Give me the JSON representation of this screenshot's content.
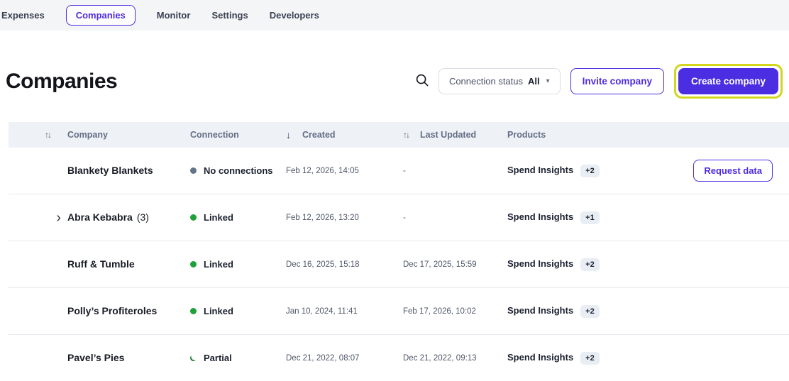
{
  "nav": {
    "items": [
      {
        "label": "Expenses",
        "active": false
      },
      {
        "label": "Companies",
        "active": true
      },
      {
        "label": "Monitor",
        "active": false
      },
      {
        "label": "Settings",
        "active": false
      },
      {
        "label": "Developers",
        "active": false
      }
    ]
  },
  "header": {
    "title": "Companies",
    "filter_label": "Connection status",
    "filter_value": "All",
    "invite_label": "Invite company",
    "create_label": "Create company"
  },
  "icons": {
    "search": "magnifier",
    "filter_caret": "▾",
    "sort_both": "↑↓",
    "sort_desc": "↓",
    "expand": "›"
  },
  "colors": {
    "accent_purple": "#4f2be0",
    "primary_button": "#4b2ee2",
    "highlight_yellow": "#d3d61d",
    "linked_green": "#1ea03a",
    "partial_green": "#1d7c2f",
    "no_connection_gray": "#64748b",
    "header_bg": "#eef1f6",
    "nav_bg": "#f4f5f7"
  },
  "table": {
    "columns": [
      {
        "label": "Company",
        "sort": "both"
      },
      {
        "label": "Connection",
        "sort": "none"
      },
      {
        "label": "Created",
        "sort": "desc"
      },
      {
        "label": "Last Updated",
        "sort": "both"
      },
      {
        "label": "Products",
        "sort": "none"
      }
    ],
    "rows": [
      {
        "name": "Blankety Blankets",
        "name_suffix": "",
        "expandable": false,
        "connection": "No connections",
        "connection_status": "none",
        "created": "Feb 12, 2026, 14:05",
        "last_updated": "-",
        "product": "Spend Insights",
        "product_badge": "+2",
        "action": "Request data"
      },
      {
        "name": "Abra Kebabra",
        "name_suffix": "(3)",
        "expandable": true,
        "connection": "Linked",
        "connection_status": "linked",
        "created": "Feb 12, 2026, 13:20",
        "last_updated": "-",
        "product": "Spend Insights",
        "product_badge": "+1",
        "action": ""
      },
      {
        "name": "Ruff & Tumble",
        "name_suffix": "",
        "expandable": false,
        "connection": "Linked",
        "connection_status": "linked",
        "created": "Dec 16, 2025, 15:18",
        "last_updated": "Dec 17, 2025, 15:59",
        "product": "Spend Insights",
        "product_badge": "+2",
        "action": ""
      },
      {
        "name": "Polly’s Profiteroles",
        "name_suffix": "",
        "expandable": false,
        "connection": "Linked",
        "connection_status": "linked",
        "created": "Jan 10, 2024, 11:41",
        "last_updated": "Feb 17, 2026, 10:02",
        "product": "Spend Insights",
        "product_badge": "+2",
        "action": ""
      },
      {
        "name": "Pavel’s Pies",
        "name_suffix": "",
        "expandable": false,
        "connection": "Partial",
        "connection_status": "partial",
        "created": "Dec 21, 2022, 08:07",
        "last_updated": "Dec 21, 2022, 09:13",
        "product": "Spend Insights",
        "product_badge": "+2",
        "action": ""
      }
    ]
  }
}
